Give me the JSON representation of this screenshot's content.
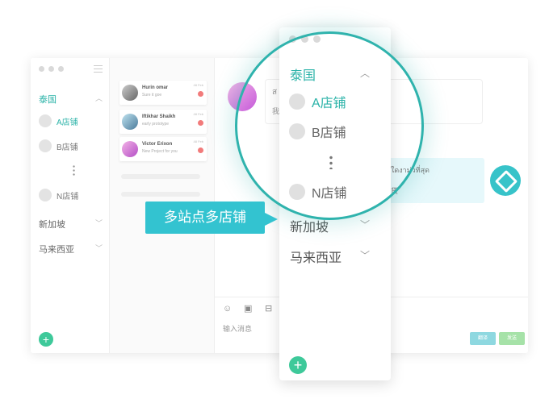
{
  "sidebar": {
    "countries": [
      {
        "label": "泰国",
        "expanded": true,
        "active": true
      },
      {
        "label": "新加坡",
        "expanded": false
      },
      {
        "label": "马来西亚",
        "expanded": false
      }
    ],
    "stores": [
      {
        "label": "A店铺",
        "active": true
      },
      {
        "label": "B店铺"
      },
      {
        "label": "N店铺"
      }
    ]
  },
  "chat_list": [
    {
      "name": "Hurin omar",
      "message": "Sure it goe",
      "time": "48 Feb"
    },
    {
      "name": "Iftikhar Shaikh",
      "message": "early prototype",
      "time": "48 Feb"
    },
    {
      "name": "Victor Erixon",
      "message": "New Project for you",
      "time": "48 Feb"
    }
  ],
  "chat": {
    "incoming_line1": "ส",
    "incoming_line2": "我",
    "reply_line1": "ใดงาม่วที่สุด",
    "reply_line2": "货"
  },
  "composer": {
    "placeholder": "输入消息",
    "translate_label": "翻译",
    "send_label": "发送"
  },
  "callout": {
    "text": "多站点多店铺"
  },
  "colors": {
    "accent": "#2bb3a8",
    "callout": "#33c3d0",
    "add": "#3ec99a",
    "badge": "#f27b7b"
  }
}
